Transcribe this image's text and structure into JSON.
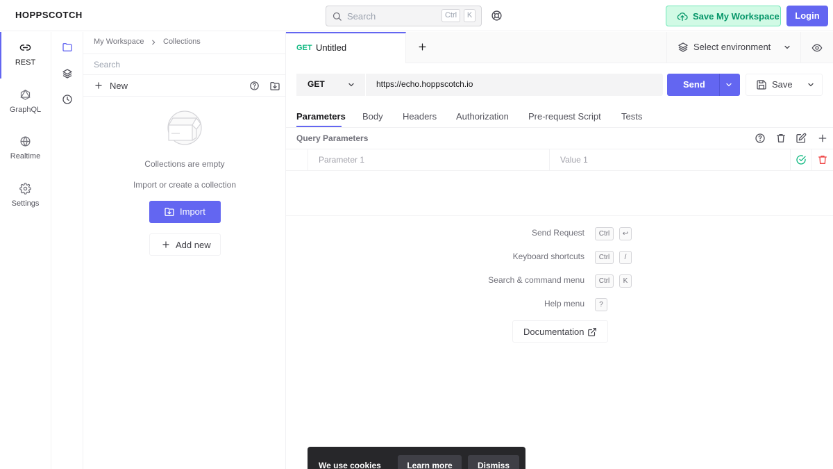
{
  "app": {
    "brand": "HOPPSCOTCH"
  },
  "header": {
    "search_placeholder": "Search",
    "search_kbd": [
      "Ctrl",
      "K"
    ],
    "save_workspace_label": "Save My Workspace",
    "login_label": "Login"
  },
  "leftnav": {
    "items": [
      {
        "label": "REST",
        "icon": "link-icon",
        "active": true
      },
      {
        "label": "GraphQL",
        "icon": "graphql-icon",
        "active": false
      },
      {
        "label": "Realtime",
        "icon": "globe-icon",
        "active": false
      },
      {
        "label": "Settings",
        "icon": "gear-icon",
        "active": false
      }
    ]
  },
  "iconcol": {
    "items": [
      "folder-icon",
      "layers-icon",
      "clock-icon"
    ]
  },
  "collections": {
    "breadcrumb": [
      "My Workspace",
      "Collections"
    ],
    "search_placeholder": "Search",
    "new_label": "New",
    "empty_title": "Collections are empty",
    "empty_subtitle": "Import or create a collection",
    "import_label": "Import",
    "add_new_label": "Add new"
  },
  "request_tab": {
    "method": "GET",
    "title": "Untitled"
  },
  "environment": {
    "label": "Select environment"
  },
  "request": {
    "method": "GET",
    "url": "https://echo.hoppscotch.io",
    "send_label": "Send",
    "save_label": "Save"
  },
  "param_tabs": [
    "Parameters",
    "Body",
    "Headers",
    "Authorization",
    "Pre-request Script",
    "Tests"
  ],
  "query_params": {
    "title": "Query Parameters",
    "key_placeholder": "Parameter 1",
    "value_placeholder": "Value 1"
  },
  "shortcuts": [
    {
      "label": "Send Request",
      "keys": [
        "Ctrl",
        "↩"
      ]
    },
    {
      "label": "Keyboard shortcuts",
      "keys": [
        "Ctrl",
        "/"
      ]
    },
    {
      "label": "Search & command menu",
      "keys": [
        "Ctrl",
        "K"
      ]
    },
    {
      "label": "Help menu",
      "keys": [
        "?"
      ]
    }
  ],
  "documentation_label": "Documentation",
  "cookie": {
    "text": "We use cookies",
    "learn_more": "Learn more",
    "dismiss": "Dismiss"
  },
  "colors": {
    "accent": "#6366f1",
    "method_green": "#10b981",
    "save_ws_bg": "#d1fae5",
    "danger": "#ef4444"
  }
}
